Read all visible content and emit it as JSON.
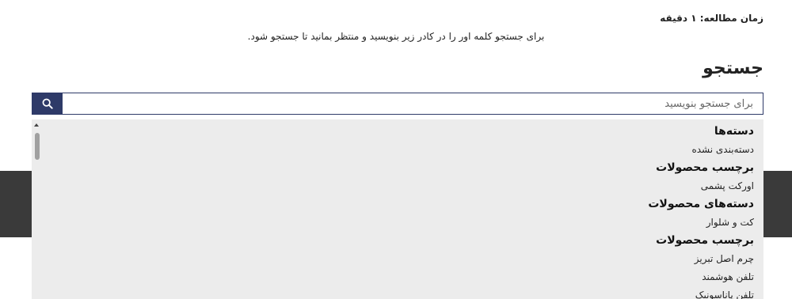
{
  "reading_time": "زمان مطالعه: ۱ دقیقه",
  "instruction": "برای جستجو کلمه اور را در کادر زیر بنویسید و منتظر بمانید تا جستجو شود.",
  "search": {
    "title": "جستجو",
    "placeholder": "برای جستجو بنویسید",
    "value": "",
    "button_icon": "search-icon"
  },
  "dropdown": {
    "groups": [
      {
        "header": "دسته‌ها",
        "items": [
          "دسته‌بندی نشده"
        ]
      },
      {
        "header": "برچسب محصولات",
        "items": [
          "اورکت پشمی"
        ]
      },
      {
        "header": "دسته‌های محصولات",
        "items": [
          "کت و شلوار"
        ]
      },
      {
        "header": "برچسب محصولات",
        "items": [
          "چرم اصل تبریز",
          "تلفن هوشمند",
          "تلفن پاناسونیک"
        ]
      }
    ]
  },
  "colors": {
    "accent": "#2e3a68",
    "dropdown_bg": "#ececec",
    "dark_band": "#3a3a3a"
  }
}
